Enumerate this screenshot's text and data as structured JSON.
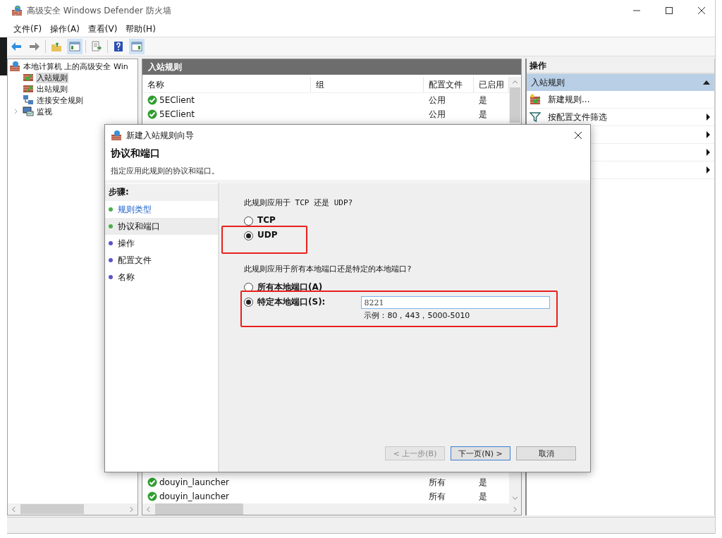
{
  "window": {
    "title": "高级安全 Windows Defender 防火墙"
  },
  "menu": [
    "文件(F)",
    "操作(A)",
    "查看(V)",
    "帮助(H)"
  ],
  "tree": {
    "label": "本地计算机 上的高级安全 Win",
    "children": [
      {
        "label": "入站规则",
        "kind": "inbound",
        "selected": true
      },
      {
        "label": "出站规则",
        "kind": "outbound",
        "selected": false
      },
      {
        "label": "连接安全规则",
        "kind": "connection",
        "selected": false
      },
      {
        "label": "监视",
        "kind": "monitor",
        "selected": false,
        "expanded": false
      }
    ]
  },
  "rules": {
    "title": "入站规则",
    "columns": [
      "名称",
      "组",
      "配置文件",
      "已启用"
    ],
    "top_rows": [
      {
        "name": "5EClient",
        "profile": "公用",
        "enabled_text": "是",
        "enabled": true
      },
      {
        "name": "5EClient",
        "profile": "公用",
        "enabled_text": "是",
        "enabled": true
      }
    ],
    "bottom_rows": [
      {
        "name": "douyin_launcher",
        "profile": "所有",
        "enabled_text": "是",
        "enabled": true
      },
      {
        "name": "douyin_launcher",
        "profile": "所有",
        "enabled_text": "是",
        "enabled": true
      }
    ]
  },
  "actions": {
    "title": "操作",
    "section": {
      "label": "入站规则",
      "expanded": true
    },
    "items": [
      {
        "label": "新建规则...",
        "kind": "action"
      },
      {
        "label": "按配置文件筛选",
        "kind": "submenu"
      }
    ]
  },
  "dialog": {
    "title": "新建入站规则向导",
    "heading": "协议和端口",
    "subtitle": "指定应用此规则的协议和端口。",
    "steps_title": "步骤:",
    "steps": [
      {
        "label": "规则类型",
        "done": true,
        "selected": false
      },
      {
        "label": "协议和端口",
        "done": true,
        "selected": true
      },
      {
        "label": "操作",
        "done": false,
        "selected": false
      },
      {
        "label": "配置文件",
        "done": false,
        "selected": false
      },
      {
        "label": "名称",
        "done": false,
        "selected": false
      }
    ],
    "protocol_question": "此规则应用于 TCP 还是 UDP?",
    "protocol_options": [
      {
        "label": "TCP",
        "selected": false
      },
      {
        "label": "UDP",
        "selected": true
      }
    ],
    "port_question": "此规则应用于所有本地端口还是特定的本地端口?",
    "port_options": [
      {
        "label": "所有本地端口(A)",
        "selected": false
      },
      {
        "label": "特定本地端口(S):",
        "selected": true
      }
    ],
    "port_field": {
      "value": "8221"
    },
    "port_example": "示例：80，443，5000-5010",
    "buttons": [
      {
        "label": "< 上一步(B)",
        "disabled": true,
        "default": false
      },
      {
        "label": "下一页(N) >",
        "disabled": false,
        "default": true
      },
      {
        "label": "取消",
        "disabled": false,
        "default": false
      }
    ]
  }
}
